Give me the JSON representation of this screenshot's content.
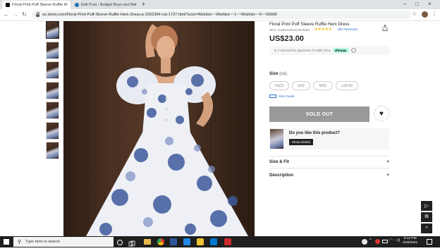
{
  "browser": {
    "tabs": [
      {
        "title": "Floral Print Puff Sleeve Ruffle H",
        "active": true,
        "favicon_color": "#111111"
      },
      {
        "title": "Edit Post ‹ Budget Buys and Bez",
        "active": false,
        "favicon_color": "#2271b1"
      }
    ],
    "url": "us.shein.com/Floral-Print-Puff-Sleeve-Ruffle-Hem-Dress-p-2262354-cat-1727.html?scici=Wishlist~~Wishlist~~1~~Wishlist~~0~~50000",
    "icons": {
      "close": "×",
      "new_tab": "+",
      "back": "←",
      "forward": "→",
      "reload": "↻",
      "minimize": "–",
      "maximize": "□",
      "star": "☆",
      "menu": "⋮"
    }
  },
  "product": {
    "title": "Floral Print Puff Sleeve Ruffle Hem Dress",
    "sku": "SKU: swdress02210303353",
    "rating_stars": "★★★★★",
    "rating_value": 4.5,
    "reviews": "(99 Reviews)",
    "price": "US$23.00",
    "afterpay_text": "or 4 interest-free payments of US$5.75 by",
    "afterpay_logo": "afterpay",
    "afterpay_info": "i",
    "size_label": "Size",
    "size_unit": "(us)",
    "sizes": [
      "XS(2)",
      "S(4)",
      "M(6)",
      "L(8/10)"
    ],
    "size_guide": "Size Guide",
    "sold_out": "SOLD OUT",
    "wishlist_icon": "♥",
    "similar_question": "Do you like this product?",
    "show_similar": "Show Similar",
    "accordion": [
      {
        "label": "Size & Fit",
        "icon": "+"
      },
      {
        "label": "Description",
        "icon": "+"
      }
    ]
  },
  "side_controls": [
    "▷",
    "⧉",
    "^"
  ],
  "taskbar": {
    "search_placeholder": "Type here to search",
    "time": "8:12 PM",
    "date": "4/26/2021"
  },
  "colors": {
    "accent_link": "#2f6fd0",
    "star": "#f4b400",
    "sold_out_bg": "#999999",
    "afterpay_mint": "#b2fce4"
  }
}
